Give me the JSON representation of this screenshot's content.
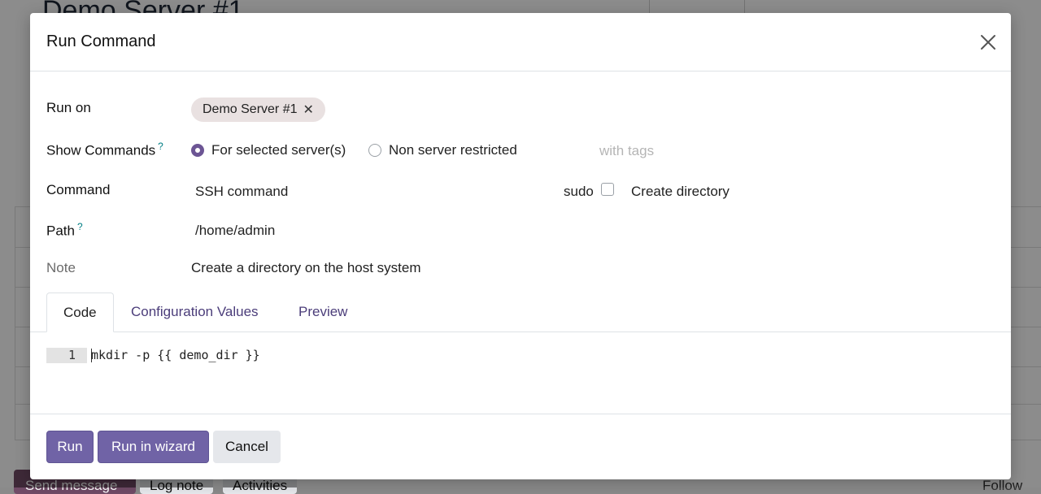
{
  "background": {
    "record_title": "Demo Server #1",
    "chatter": {
      "send_message": "Send message",
      "log_note": "Log note",
      "activities": "Activities",
      "follow": "Follow"
    }
  },
  "dialog": {
    "title": "Run Command",
    "fields": {
      "run_on": {
        "label": "Run on",
        "tag": "Demo Server #1"
      },
      "show_commands": {
        "label": "Show Commands",
        "help": "?",
        "options": [
          "For selected server(s)",
          "Non server restricted"
        ],
        "selected": "For selected server(s)",
        "tags_placeholder": "with tags"
      },
      "command": {
        "label": "Command",
        "type_value": "SSH command",
        "sudo_label": "sudo",
        "sudo_checked": false,
        "name": "Create directory"
      },
      "path": {
        "label": "Path",
        "help": "?",
        "value": "/home/admin"
      },
      "note": {
        "label": "Note",
        "value": "Create a directory on the host system"
      }
    },
    "tabs": [
      {
        "label": "Code",
        "active": true
      },
      {
        "label": "Configuration Values",
        "active": false
      },
      {
        "label": "Preview",
        "active": false
      }
    ],
    "editor": {
      "line_number": "1",
      "code": "mkdir -p {{ demo_dir }}"
    },
    "footer": {
      "run": "Run",
      "run_in_wizard": "Run in wizard",
      "cancel": "Cancel"
    }
  },
  "colors": {
    "primary": "#7063a6",
    "radio_checked": "#6c5594",
    "tab_link": "#4b3d7a",
    "tag_bg": "#e9e1e1"
  }
}
